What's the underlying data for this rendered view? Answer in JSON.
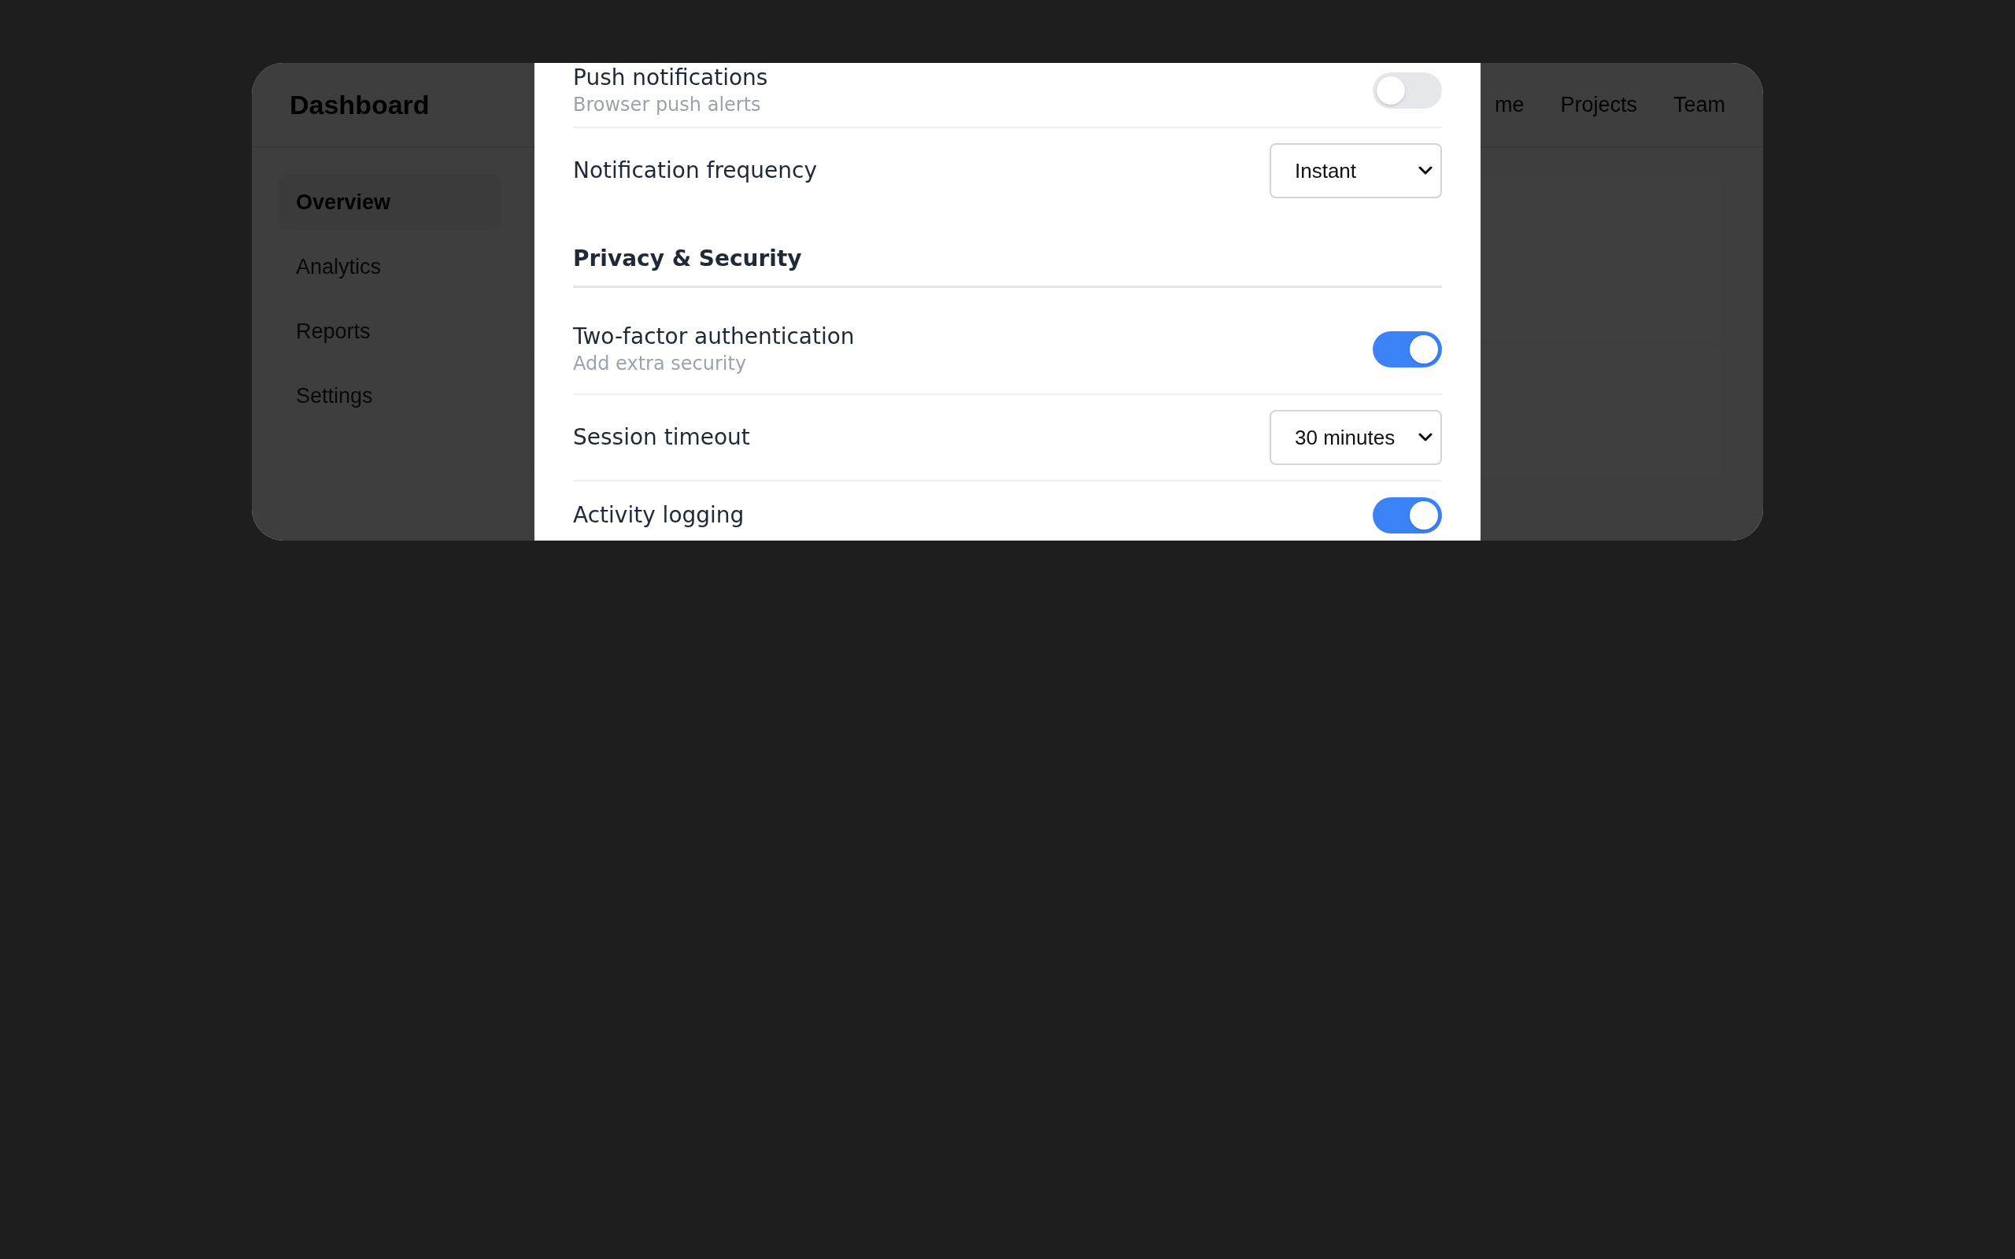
{
  "app": {
    "title": "Dashboard",
    "nav": [
      {
        "label": "me"
      },
      {
        "label": "Projects"
      },
      {
        "label": "Team"
      }
    ]
  },
  "sidebar": {
    "items": [
      {
        "label": "Overview",
        "selected": true
      },
      {
        "label": "Analytics",
        "selected": false
      },
      {
        "label": "Reports",
        "selected": false
      },
      {
        "label": "Settings",
        "selected": false
      }
    ]
  },
  "settings_modal": {
    "rows": [
      {
        "kind": "toggle",
        "label": "Push notifications",
        "description": "Browser push alerts",
        "on": false
      },
      {
        "kind": "select",
        "label": "Notification frequency",
        "value": "Instant"
      },
      {
        "kind": "section",
        "label": "Privacy & Security"
      },
      {
        "kind": "toggle",
        "label": "Two-factor authentication",
        "description": "Add extra security",
        "on": true
      },
      {
        "kind": "select",
        "label": "Session timeout",
        "value": "30 minutes"
      },
      {
        "kind": "toggle",
        "label": "Activity logging",
        "on": true
      }
    ]
  }
}
